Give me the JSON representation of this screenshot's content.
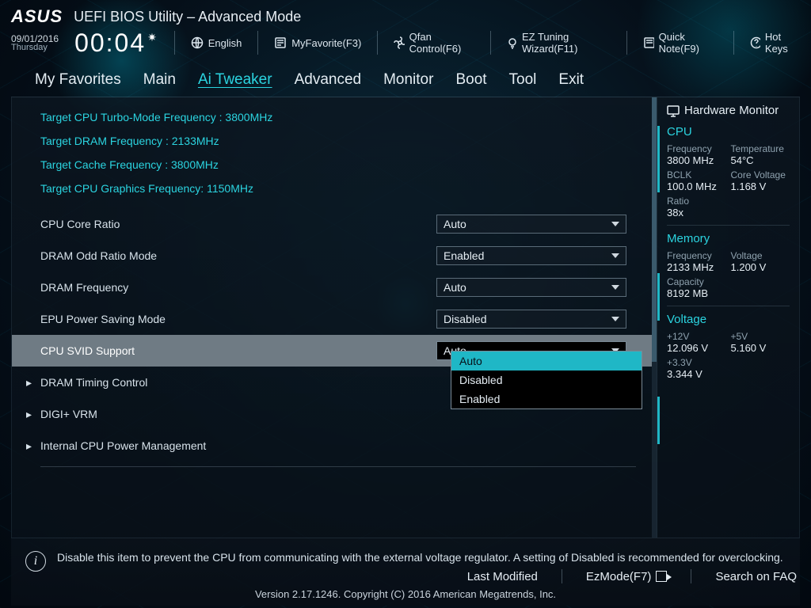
{
  "header": {
    "brand": "ASUS",
    "title": "UEFI BIOS Utility – Advanced Mode",
    "date": "09/01/2016",
    "day": "Thursday",
    "time": "00:04",
    "language": "English",
    "toolbar": {
      "favorite": "MyFavorite(F3)",
      "qfan": "Qfan Control(F6)",
      "eztune": "EZ Tuning Wizard(F11)",
      "quicknote": "Quick Note(F9)",
      "hotkeys": "Hot Keys"
    }
  },
  "tabs": [
    "My Favorites",
    "Main",
    "Ai Tweaker",
    "Advanced",
    "Monitor",
    "Boot",
    "Tool",
    "Exit"
  ],
  "active_tab": "Ai Tweaker",
  "targets": {
    "turbo": "Target CPU Turbo-Mode Frequency : 3800MHz",
    "dram": "Target DRAM Frequency : 2133MHz",
    "cache": "Target Cache Frequency : 3800MHz",
    "gfx": "Target CPU Graphics Frequency: 1150MHz"
  },
  "settings": {
    "cpu_core_ratio": {
      "label": "CPU Core Ratio",
      "value": "Auto"
    },
    "dram_odd_ratio": {
      "label": "DRAM Odd Ratio Mode",
      "value": "Enabled"
    },
    "dram_freq": {
      "label": "DRAM Frequency",
      "value": "Auto"
    },
    "epu": {
      "label": "EPU Power Saving Mode",
      "value": "Disabled"
    },
    "svid": {
      "label": "CPU SVID Support",
      "value": "Auto",
      "options": [
        "Auto",
        "Disabled",
        "Enabled"
      ]
    },
    "dram_timing": {
      "label": "DRAM Timing Control"
    },
    "digi_vrm": {
      "label": "DIGI+ VRM"
    },
    "icpm": {
      "label": "Internal CPU Power Management"
    }
  },
  "help_text": "Disable this item to prevent the CPU from communicating with the external voltage regulator. A setting of Disabled is recommended for overclocking.",
  "hwmon": {
    "title": "Hardware Monitor",
    "cpu": {
      "heading": "CPU",
      "freq": {
        "k": "Frequency",
        "v": "3800 MHz"
      },
      "temp": {
        "k": "Temperature",
        "v": "54°C"
      },
      "bclk": {
        "k": "BCLK",
        "v": "100.0 MHz"
      },
      "vcore": {
        "k": "Core Voltage",
        "v": "1.168 V"
      },
      "ratio": {
        "k": "Ratio",
        "v": "38x"
      }
    },
    "mem": {
      "heading": "Memory",
      "freq": {
        "k": "Frequency",
        "v": "2133 MHz"
      },
      "volt": {
        "k": "Voltage",
        "v": "1.200 V"
      },
      "cap": {
        "k": "Capacity",
        "v": "8192 MB"
      }
    },
    "volt": {
      "heading": "Voltage",
      "p12": {
        "k": "+12V",
        "v": "12.096 V"
      },
      "p5": {
        "k": "+5V",
        "v": "5.160 V"
      },
      "p33": {
        "k": "+3.3V",
        "v": "3.344 V"
      }
    }
  },
  "footer": {
    "last_modified": "Last Modified",
    "ezmode": "EzMode(F7)",
    "search": "Search on FAQ",
    "version": "Version 2.17.1246. Copyright (C) 2016 American Megatrends, Inc."
  }
}
